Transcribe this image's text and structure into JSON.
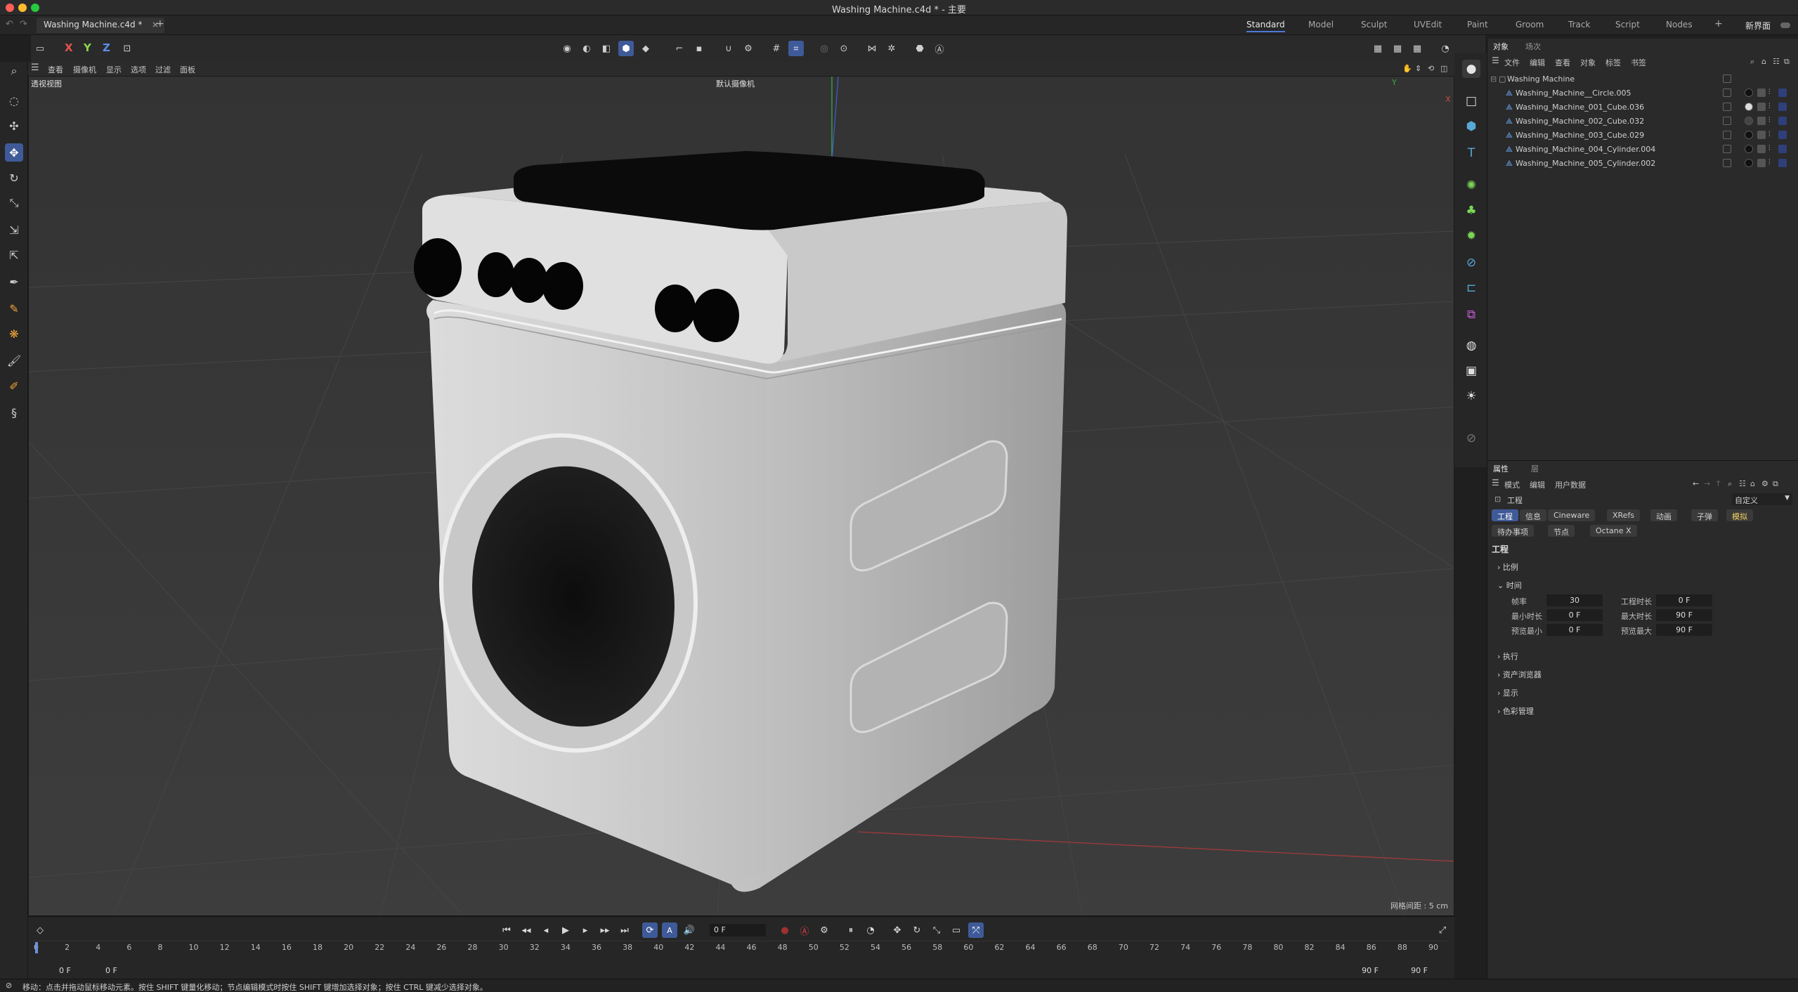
{
  "window": {
    "title": "Washing Machine.c4d * - 主要"
  },
  "doc_tab": {
    "label": "Washing Machine.c4d *",
    "close": "×",
    "add": "+"
  },
  "layouts": [
    "Standard",
    "Model",
    "Sculpt",
    "UVEdit",
    "Paint",
    "Groom",
    "Track",
    "Script",
    "Nodes"
  ],
  "layouts_extra": {
    "add": "+",
    "new_layout": "新界面"
  },
  "toolbar": {
    "axis_x": "X",
    "axis_y": "Y",
    "axis_z": "Z"
  },
  "viewport_menu": {
    "items": [
      "查看",
      "摄像机",
      "显示",
      "选项",
      "过滤",
      "面板"
    ]
  },
  "viewport": {
    "view_name": "透视视图",
    "camera": "默认摄像机",
    "grid_info": "网格间距 : 5 cm",
    "axis_y": "Y",
    "axis_x": "X"
  },
  "object_manager": {
    "tabs": [
      "对象",
      "场次"
    ],
    "menu": [
      "文件",
      "编辑",
      "查看",
      "对象",
      "标签",
      "书签"
    ],
    "root": "Washing Machine",
    "children": [
      "Washing_Machine__Circle.005",
      "Washing_Machine_001_Cube.036",
      "Washing_Machine_002_Cube.032",
      "Washing_Machine_003_Cube.029",
      "Washing_Machine_004_Cylinder.004",
      "Washing_Machine_005_Cylinder.002"
    ]
  },
  "attribute_manager": {
    "tabs": [
      "属性",
      "层"
    ],
    "menu": [
      "模式",
      "编辑",
      "用户数据"
    ],
    "object_type": "工程",
    "preset": "自定义",
    "chips_row1": [
      "工程",
      "信息",
      "Cineware",
      "XRefs",
      "动画",
      "子弹",
      "模拟"
    ],
    "chips_row2": [
      "待办事项",
      "节点",
      "Octane X"
    ],
    "heading": "工程",
    "sections": [
      "比例",
      "时间",
      "执行",
      "资产浏览器",
      "显示",
      "色彩管理"
    ],
    "time_fields": {
      "fps_label": "帧率",
      "fps": "30",
      "project_length_label": "工程时长",
      "project_length": "0 F",
      "min_label": "最小时长",
      "min": "0 F",
      "max_label": "最大时长",
      "max": "90 F",
      "preview_min_label": "预览最小",
      "preview_min": "0 F",
      "preview_max_label": "预览最大",
      "preview_max": "90 F"
    }
  },
  "timeline": {
    "current_frame": "0 F",
    "ticks": [
      "0",
      "2",
      "4",
      "6",
      "8",
      "10",
      "12",
      "14",
      "16",
      "18",
      "20",
      "22",
      "24",
      "26",
      "28",
      "30",
      "32",
      "34",
      "36",
      "38",
      "40",
      "42",
      "44",
      "46",
      "48",
      "50",
      "52",
      "54",
      "56",
      "58",
      "60",
      "62",
      "64",
      "66",
      "68",
      "70",
      "72",
      "74",
      "76",
      "78",
      "80",
      "82",
      "84",
      "86",
      "88",
      "90"
    ],
    "start_field": "0 F",
    "start_field2": "0 F",
    "end_field": "90 F",
    "end_field2": "90 F"
  },
  "status": {
    "text": "移动：点击并拖动鼠标移动元素。按住 SHIFT 键量化移动；节点编辑模式时按住 SHIFT 键增加选择对象；按住 CTRL 键减少选择对象。"
  },
  "colors": {
    "accent": "#3f5a98",
    "layout_active": "#4d79d6",
    "object_icon": "#6db2ff"
  }
}
